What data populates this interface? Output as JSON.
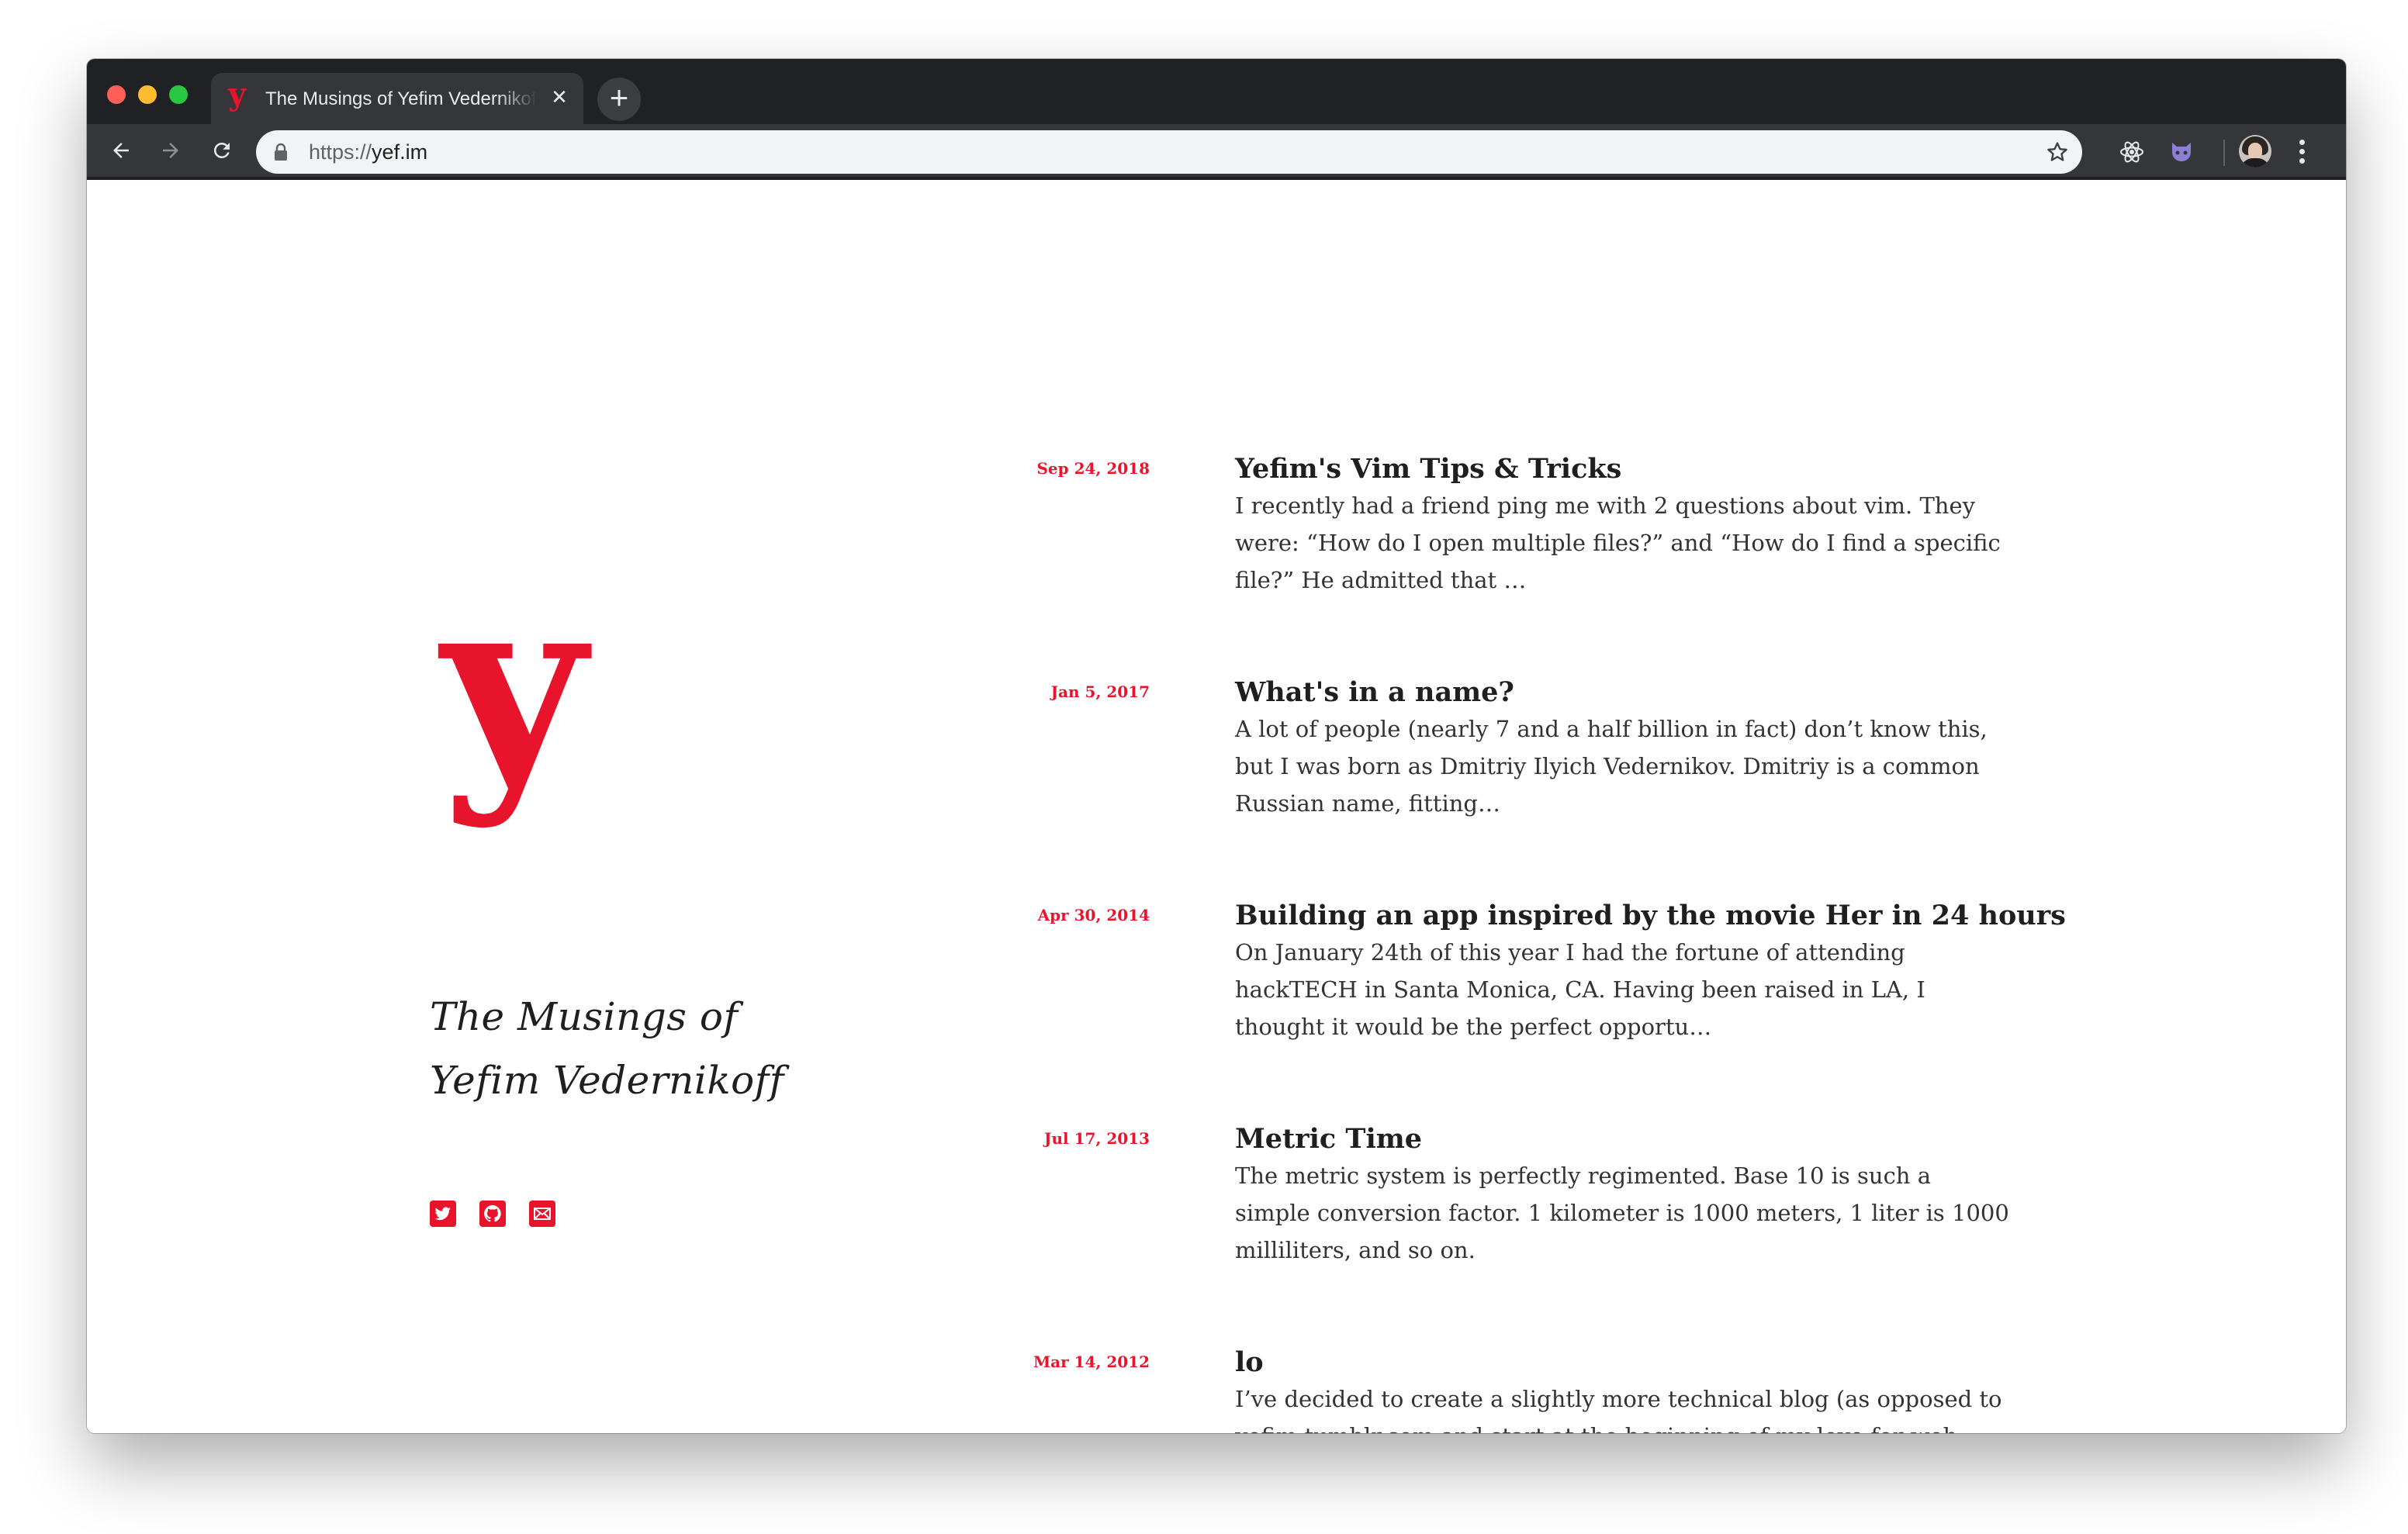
{
  "browser": {
    "tab": {
      "title": "The Musings of Yefim Vedernikoff",
      "favicon_letter": "y"
    },
    "url": {
      "scheme": "https://",
      "host": "yef.im"
    }
  },
  "site": {
    "logo_letter": "y",
    "title_line1": "The Musings of",
    "title_line2": "Yefim Vedernikoff",
    "brand_color": "#e8142b",
    "social_icons": [
      "twitter-icon",
      "github-icon",
      "mail-icon"
    ]
  },
  "posts": [
    {
      "date": "Sep 24, 2018",
      "title": "Yefim's Vim Tips & Tricks",
      "excerpt": "I recently had a friend ping me with 2 questions about vim. They were: “How do I open multiple files?” and “How do I find a specific file?” He admitted that …"
    },
    {
      "date": "Jan 5, 2017",
      "title": "What's in a name?",
      "excerpt": "A lot of people (nearly 7 and a half billion in fact) don’t know this, but I was born as Dmitriy Ilyich Vedernikov. Dmitriy is a common Russian name, fitting…"
    },
    {
      "date": "Apr 30, 2014",
      "title": "Building an app inspired by the movie Her in 24 hours",
      "excerpt": "On January 24th of this year I had the fortune of attending hackTECH in Santa Monica, CA. Having been raised in LA, I thought it would be the perfect opportu…"
    },
    {
      "date": "Jul 17, 2013",
      "title": "Metric Time",
      "excerpt": "The metric system is perfectly regimented. Base 10 is such a simple conversion factor. 1 kilometer is 1000 meters, 1 liter is 1000 milliliters, and so on."
    },
    {
      "date": "Mar 14, 2012",
      "title": "lo",
      "excerpt": "I’ve decided to create a slightly more technical blog (as opposed to yefim.tumblr.com and start at the beginning of my love for web development. I like to at…"
    }
  ]
}
